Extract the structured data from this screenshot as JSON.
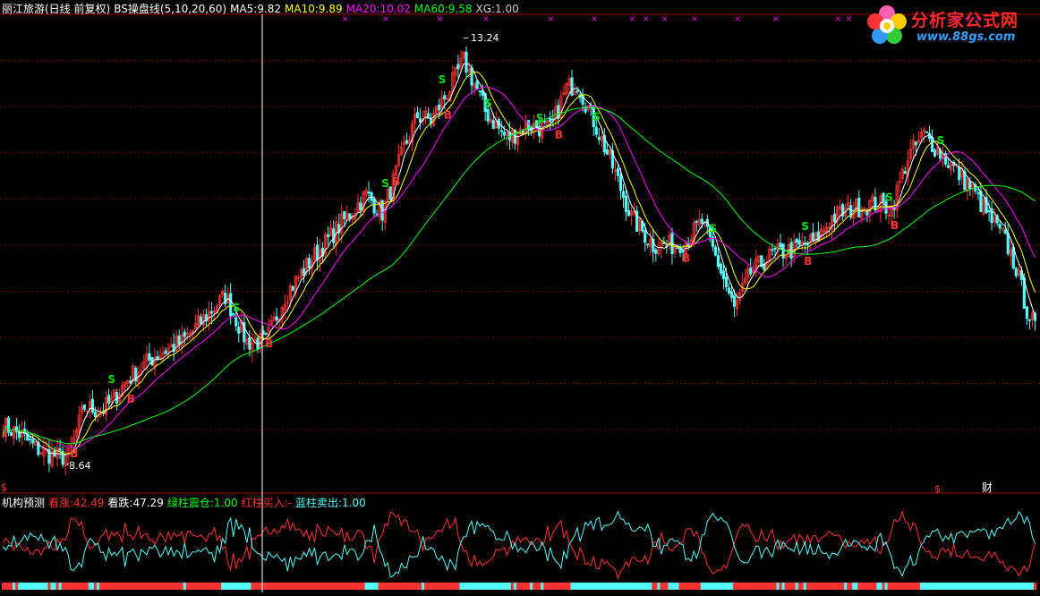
{
  "header": {
    "stock_name": "丽江旅游(日线 前复权)",
    "indicator_name": "BS操盘线(5,10,20,60)",
    "ma5_label": "MA5:",
    "ma5_value": "9.82",
    "ma10_label": "MA10:",
    "ma10_value": "9.89",
    "ma20_label": "MA20:",
    "ma20_value": "10.02",
    "ma60_label": "MA60:",
    "ma60_value": "9.58",
    "xg_label": "XG:",
    "xg_value": "1.00"
  },
  "indicator_header": {
    "title": "机构预测",
    "up_label": "看涨:",
    "up_value": "42.49",
    "down_label": "看跌:",
    "down_value": "47.29",
    "green_label": "绿柱震仓:",
    "green_value": "1.00",
    "red_label": "红柱买入:",
    "red_value": "-",
    "blue_label": "蓝柱卖出:",
    "blue_value": "1.00"
  },
  "logo": {
    "brand": "分析家公式网",
    "site": "www.88gs.com"
  },
  "colors": {
    "up": "#ff3232",
    "down": "#54fcfc",
    "ma5": "#ffffff",
    "ma10": "#ffff00",
    "ma20": "#ff00ff",
    "ma60": "#00ff00",
    "grid": "#7a0000",
    "buy": "#ff3232",
    "sell": "#00e000"
  },
  "chart_data": {
    "type": "candlestick",
    "price_range": [
      8.4,
      13.5
    ],
    "high_label": "13.24",
    "low_label": "8.64",
    "bottom_marks": [
      "$",
      "$",
      "财"
    ],
    "xg_mark": "×",
    "signals": [
      {
        "text": "B",
        "bar": 26
      },
      {
        "text": "S",
        "bar": 40
      },
      {
        "text": "B",
        "bar": 47
      },
      {
        "text": "S",
        "bar": 86
      },
      {
        "text": "B",
        "bar": 98
      },
      {
        "text": "S",
        "bar": 141
      },
      {
        "text": "B",
        "bar": 145
      },
      {
        "text": "S",
        "bar": 162
      },
      {
        "text": "B",
        "bar": 164
      },
      {
        "text": "S",
        "bar": 179
      },
      {
        "text": "S",
        "bar": 198
      },
      {
        "text": "B",
        "bar": 205
      },
      {
        "text": "S",
        "bar": 219
      },
      {
        "text": "B",
        "bar": 252
      },
      {
        "text": "S",
        "bar": 262
      },
      {
        "text": "S",
        "bar": 296
      },
      {
        "text": "B",
        "bar": 297
      },
      {
        "text": "S",
        "bar": 327
      },
      {
        "text": "B",
        "bar": 329
      },
      {
        "text": "S",
        "bar": 346
      }
    ],
    "close_keypoints": [
      [
        0,
        9.05
      ],
      [
        6,
        8.95
      ],
      [
        12,
        8.8
      ],
      [
        18,
        8.72
      ],
      [
        24,
        8.7
      ],
      [
        30,
        9.25
      ],
      [
        36,
        9.2
      ],
      [
        40,
        9.3
      ],
      [
        46,
        9.55
      ],
      [
        56,
        9.8
      ],
      [
        66,
        9.95
      ],
      [
        74,
        10.2
      ],
      [
        82,
        10.45
      ],
      [
        86,
        10.2
      ],
      [
        90,
        9.95
      ],
      [
        97,
        9.95
      ],
      [
        104,
        10.45
      ],
      [
        114,
        10.85
      ],
      [
        124,
        11.2
      ],
      [
        134,
        11.55
      ],
      [
        140,
        11.35
      ],
      [
        143,
        11.6
      ],
      [
        148,
        12.05
      ],
      [
        153,
        12.4
      ],
      [
        158,
        12.35
      ],
      [
        165,
        12.7
      ],
      [
        170,
        13.0
      ],
      [
        174,
        12.75
      ],
      [
        178,
        12.45
      ],
      [
        186,
        12.15
      ],
      [
        194,
        12.3
      ],
      [
        202,
        12.25
      ],
      [
        208,
        12.7
      ],
      [
        212,
        12.75
      ],
      [
        218,
        12.35
      ],
      [
        225,
        11.85
      ],
      [
        232,
        11.3
      ],
      [
        240,
        11.0
      ],
      [
        248,
        11.0
      ],
      [
        252,
        11.05
      ],
      [
        258,
        11.25
      ],
      [
        264,
        10.8
      ],
      [
        270,
        10.3
      ],
      [
        276,
        10.7
      ],
      [
        284,
        10.9
      ],
      [
        292,
        10.95
      ],
      [
        300,
        11.05
      ],
      [
        306,
        11.3
      ],
      [
        314,
        11.4
      ],
      [
        322,
        11.45
      ],
      [
        328,
        11.4
      ],
      [
        334,
        11.95
      ],
      [
        340,
        12.2
      ],
      [
        346,
        12.0
      ],
      [
        352,
        11.8
      ],
      [
        358,
        11.6
      ],
      [
        364,
        11.3
      ],
      [
        370,
        11.05
      ],
      [
        374,
        10.75
      ],
      [
        378,
        10.3
      ],
      [
        381,
        10.1
      ]
    ],
    "bar_count": 382,
    "indicator": {
      "series": [
        {
          "name": "看涨",
          "color": "#ff3232"
        },
        {
          "name": "看跌",
          "color": "#54fcfc"
        }
      ],
      "range": [
        0,
        100
      ]
    }
  }
}
